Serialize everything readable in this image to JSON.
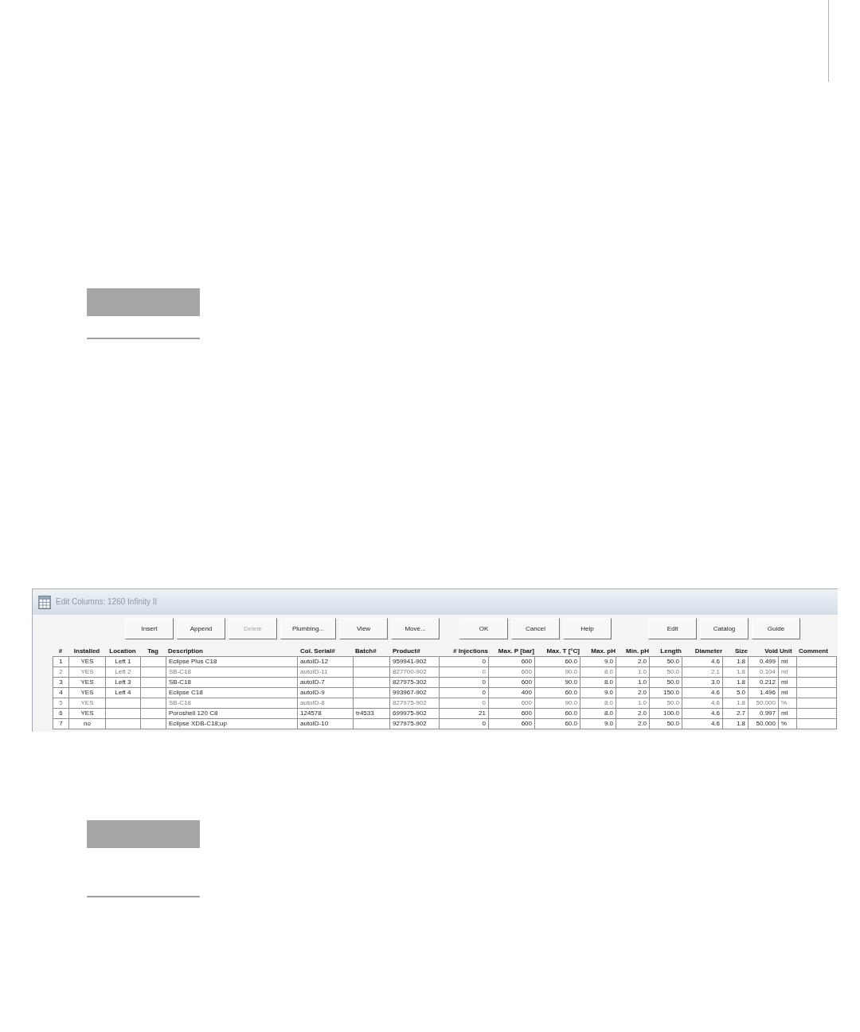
{
  "dialog": {
    "title": "Edit Columns: 1260 Infinity II",
    "toolbar": [
      {
        "buttons": [
          {
            "label": "Insert",
            "disabled": false
          },
          {
            "label": "Append",
            "disabled": false
          },
          {
            "label": "Delete",
            "disabled": true
          },
          {
            "label": "Plumbing...",
            "disabled": false
          },
          {
            "label": "View",
            "disabled": false
          },
          {
            "label": "Move...",
            "disabled": false
          }
        ]
      },
      {
        "buttons": [
          {
            "label": "OK",
            "disabled": false
          },
          {
            "label": "Cancel",
            "disabled": false
          },
          {
            "label": "Help",
            "disabled": false
          }
        ]
      },
      {
        "buttons": [
          {
            "label": "Edit",
            "disabled": false
          },
          {
            "label": "Catalog",
            "disabled": false
          },
          {
            "label": "Guide",
            "disabled": false
          }
        ]
      }
    ],
    "table": {
      "columns": [
        "#",
        "Installed",
        "Location",
        "Tag",
        "Description",
        "Col. Serial#",
        "Batch#",
        "Product#",
        "# Injections",
        "Max. P [bar]",
        "Max. T [°C]",
        "Max. pH",
        "Min. pH",
        "Length",
        "Diameter",
        "Size",
        "Void",
        "Unit",
        "Comment"
      ],
      "rows": [
        {
          "dimmed": false,
          "number": "1",
          "installed": "YES",
          "location": "Left 1",
          "description": "Eclipse Plus C18",
          "col_serial": "autoID-12",
          "product": "959941-902",
          "injections": "0",
          "max_p": "600",
          "max_t": "60.0",
          "max_ph": "9.0",
          "min_ph": "2.0",
          "length": "50.0",
          "diameter": "4.6",
          "size": "1.8",
          "void": "0.499",
          "unit": "ml"
        },
        {
          "dimmed": true,
          "number": "2",
          "installed": "YES",
          "location": "Left 2",
          "description": "SB-C18",
          "col_serial": "autoID-11",
          "product": "827700-902",
          "injections": "0",
          "max_p": "600",
          "max_t": "90.0",
          "max_ph": "8.0",
          "min_ph": "1.0",
          "length": "50.0",
          "diameter": "2.1",
          "size": "1.8",
          "void": "0.104",
          "unit": "ml"
        },
        {
          "dimmed": false,
          "number": "3",
          "installed": "YES",
          "location": "Left 3",
          "description": "SB-C18",
          "col_serial": "autoID-7",
          "product": "827975-302",
          "injections": "0",
          "max_p": "600",
          "max_t": "90.0",
          "max_ph": "8.0",
          "min_ph": "1.0",
          "length": "50.0",
          "diameter": "3.0",
          "size": "1.8",
          "void": "0.212",
          "unit": "ml"
        },
        {
          "dimmed": false,
          "number": "4",
          "installed": "YES",
          "location": "Left 4",
          "description": "Eclipse C18",
          "col_serial": "autoID-9",
          "product": "993967-902",
          "injections": "0",
          "max_p": "400",
          "max_t": "60.0",
          "max_ph": "9.0",
          "min_ph": "2.0",
          "length": "150.0",
          "diameter": "4.6",
          "size": "5.0",
          "void": "1.496",
          "unit": "ml"
        },
        {
          "dimmed": true,
          "number": "5",
          "installed": "YES",
          "description": "SB-C18",
          "col_serial": "autoID-8",
          "product": "827975-902",
          "injections": "0",
          "max_p": "600",
          "max_t": "90.0",
          "max_ph": "8.0",
          "min_ph": "1.0",
          "length": "50.0",
          "diameter": "4.6",
          "size": "1.8",
          "void": "50.000",
          "unit": "%"
        },
        {
          "dimmed": false,
          "number": "6",
          "installed": "YES",
          "description": "Poroshell 120 C8",
          "col_serial": "124578",
          "batch": "tr4533",
          "product": "699975-902",
          "injections": "21",
          "max_p": "600",
          "max_t": "60.0",
          "max_ph": "8.0",
          "min_ph": "2.0",
          "length": "100.0",
          "diameter": "4.6",
          "size": "2.7",
          "void": "0.997",
          "unit": "ml"
        },
        {
          "dimmed": false,
          "number": "7",
          "installed": "no",
          "description": "Eclipse XDB-C18;up",
          "col_serial": "autoID-10",
          "product": "927975-902",
          "injections": "0",
          "max_p": "600",
          "max_t": "60.0",
          "max_ph": "9.0",
          "min_ph": "2.0",
          "length": "50.0",
          "diameter": "4.6",
          "size": "1.8",
          "void": "50.000",
          "unit": "%"
        }
      ]
    }
  }
}
